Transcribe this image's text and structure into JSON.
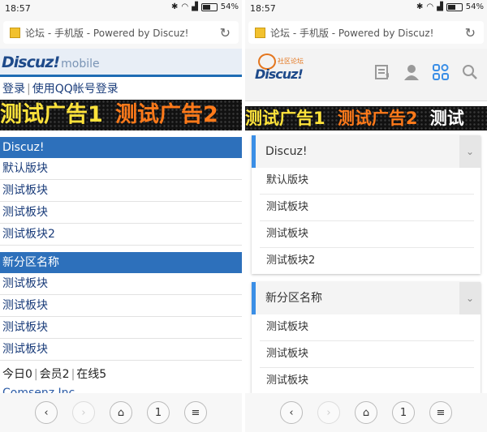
{
  "status": {
    "time": "18:57",
    "battery": "54%"
  },
  "browser": {
    "title": "论坛 - 手机版 - Powered by Discuz!",
    "tab_count": "1"
  },
  "left": {
    "logo": "Discuz!",
    "logo_suffix": "mobile",
    "login": "登录",
    "qq_login": "使用QQ帐号登录",
    "ad": [
      "测试广告1",
      "测试广告2"
    ],
    "categories": [
      {
        "name": "Discuz!",
        "forums": [
          "默认版块",
          "测试板块",
          "测试板块",
          "测试板块2"
        ]
      },
      {
        "name": "新分区名称",
        "forums": [
          "测试板块",
          "测试板块",
          "测试板块",
          "测试板块"
        ]
      }
    ],
    "stats": {
      "today": "今日0",
      "members": "会员2",
      "online": "在线5"
    },
    "footer": "Comsenz Inc."
  },
  "right": {
    "logo_word": "Discuz!",
    "logo_sub": "社区论坛",
    "ad": [
      "测试广告1",
      "测试广告2",
      "测试"
    ],
    "categories": [
      {
        "name": "Discuz!",
        "forums": [
          "默认版块",
          "测试板块",
          "测试板块",
          "测试板块2"
        ]
      },
      {
        "name": "新分区名称",
        "forums": [
          "测试板块",
          "测试板块",
          "测试板块"
        ]
      }
    ]
  },
  "colors": {
    "accent": "#2d70bb",
    "card_accent": "#3a8ee6",
    "ad_yellow": "#ffe33b",
    "ad_orange": "#ff7a1a"
  },
  "icons": [
    "back-icon",
    "forward-icon",
    "home-icon",
    "menu-icon",
    "reload-icon",
    "wifi-icon",
    "bluetooth-icon",
    "signal-icon",
    "battery-icon",
    "news-icon",
    "user-icon",
    "grid-icon",
    "search-icon",
    "chevron-down-icon"
  ]
}
